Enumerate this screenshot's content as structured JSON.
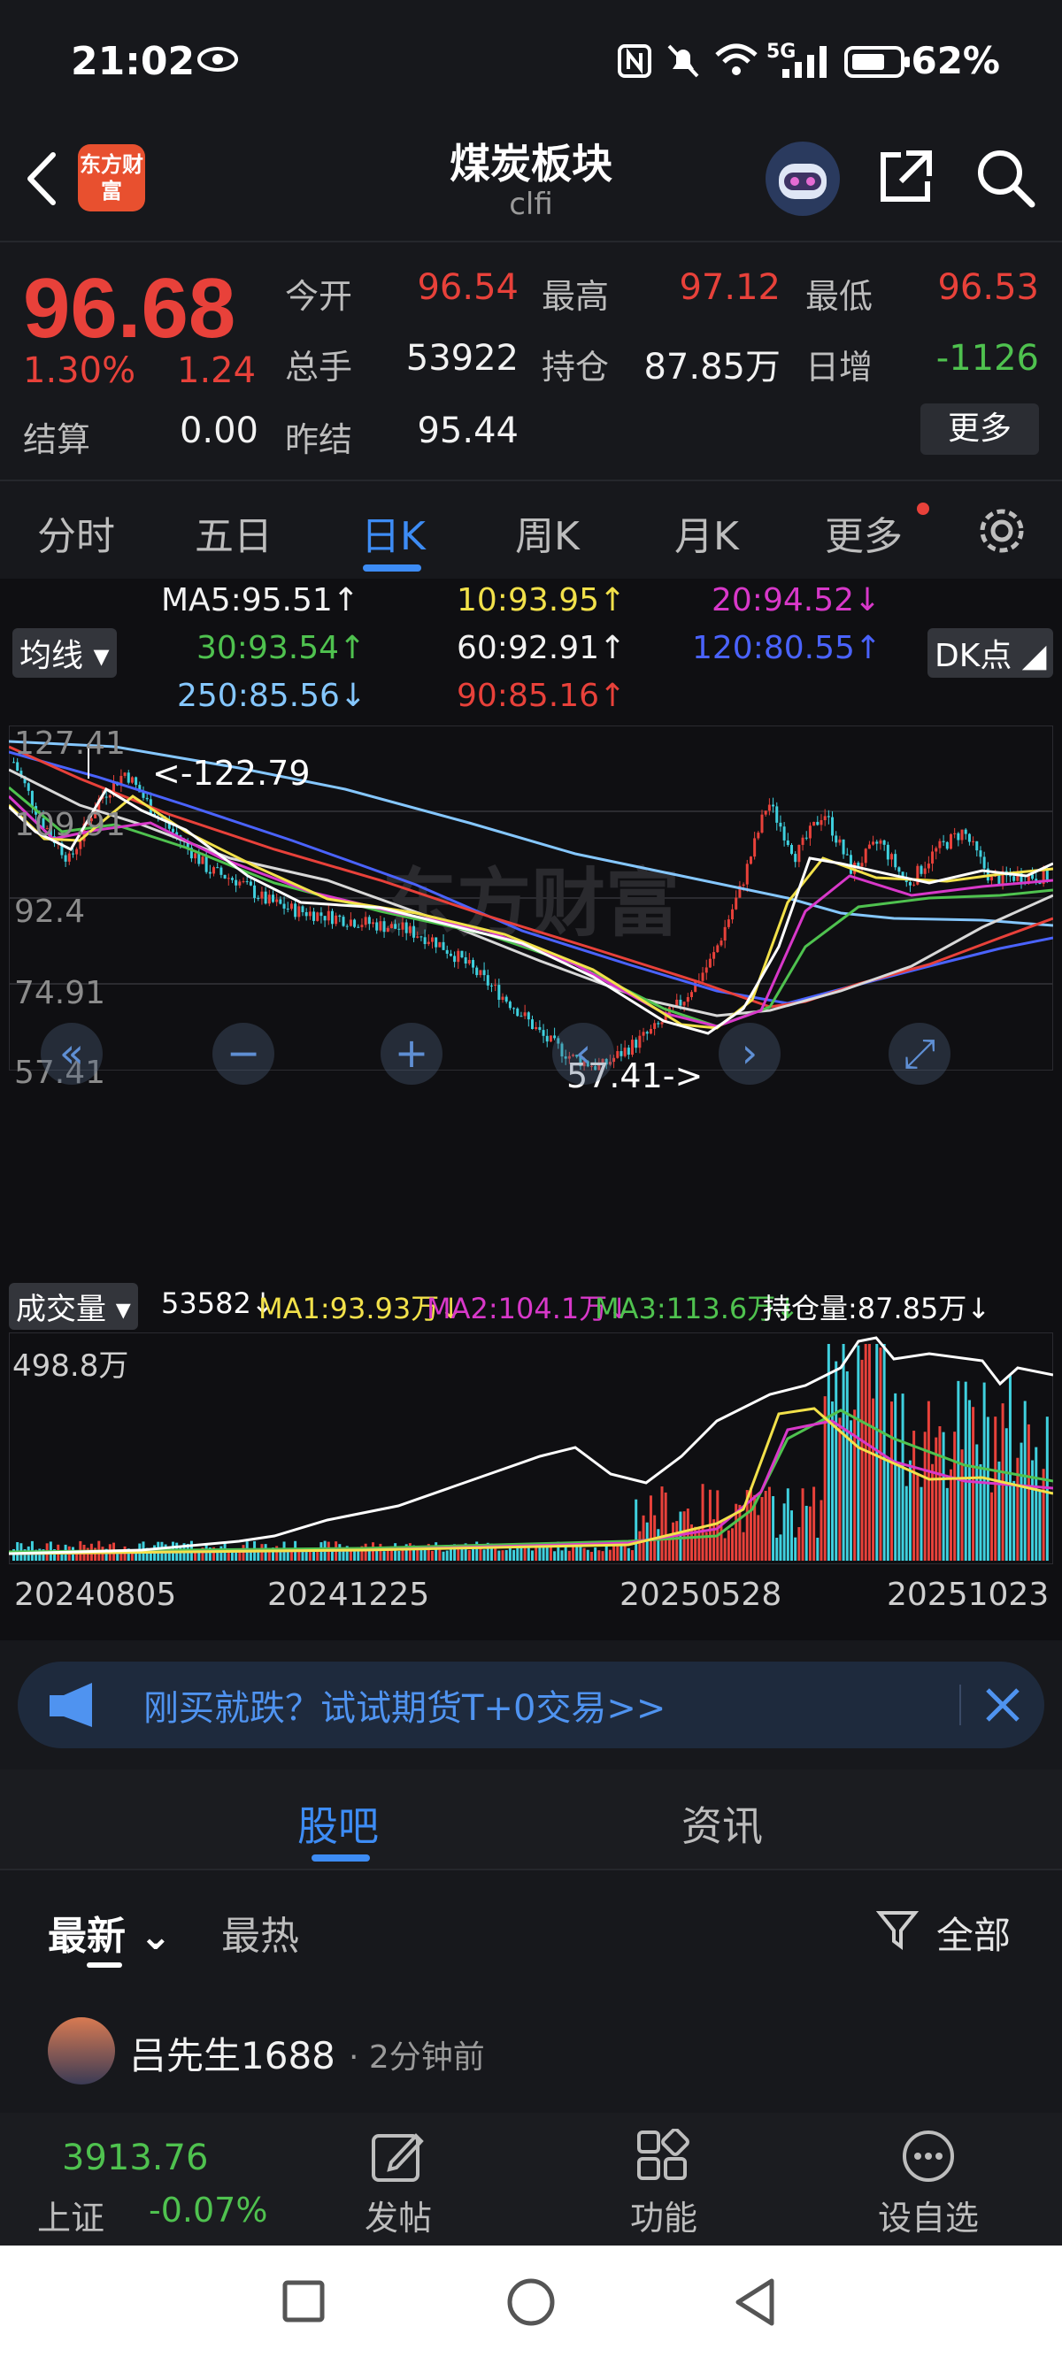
{
  "status_bar": {
    "time": "21:02",
    "network": "5G",
    "battery": "62%"
  },
  "header": {
    "title": "煤炭板块",
    "subtitle": "clfi",
    "logo_text": "东方财富"
  },
  "quote": {
    "price": "96.68",
    "change_pct": "1.30%",
    "change_abs": "1.24",
    "open_label": "今开",
    "open": "96.54",
    "high_label": "最高",
    "high": "97.12",
    "low_label": "最低",
    "low": "96.53",
    "volume_label": "总手",
    "volume": "53922",
    "position_label": "持仓",
    "position": "87.85万",
    "daily_inc_label": "日增",
    "daily_inc": "-1126",
    "settle_label": "结算",
    "settle": "0.00",
    "prev_settle_label": "昨结",
    "prev_settle": "95.44",
    "more_label": "更多"
  },
  "period_tabs": [
    "分时",
    "五日",
    "日K",
    "周K",
    "月K",
    "更多"
  ],
  "active_tab": "日K",
  "chart": {
    "ma_selector": "均线",
    "dk_button": "DK点",
    "ma": {
      "ma5": "MA5:95.51↑",
      "ma10": "10:93.95↑",
      "ma20": "20:94.52↓",
      "ma30": "30:93.54↑",
      "ma60": "60:92.91↑",
      "ma120": "120:80.55↑",
      "ma250": "250:85.56↓",
      "ma90": "90:85.16↑"
    },
    "y_labels": [
      "127.41",
      "109.91",
      "92.4",
      "74.91",
      "57.41"
    ],
    "high_marker": "<-122.79",
    "low_marker": "57.41->",
    "watermark": "东方财富",
    "volume_selector": "成交量",
    "volume_legend": {
      "vol": "53582↓",
      "ma1": "MA1:93.93万↓",
      "ma2": "MA2:104.1万↓",
      "ma3": "MA3:113.6万↓",
      "oi": "持仓量:87.85万↓"
    },
    "volume_max": "498.8万",
    "dates": [
      "20240805",
      "20241225",
      "20250528",
      "20251023"
    ]
  },
  "chart_data": {
    "type": "candlestick",
    "ylim": [
      57.41,
      127.41
    ],
    "high": 122.79,
    "low": 57.41,
    "x_dates": [
      "20240805",
      "20241225",
      "20250528",
      "20251023"
    ],
    "close_trend": [
      120,
      108,
      100,
      112,
      118,
      110,
      104,
      98,
      96,
      92,
      90,
      89,
      88,
      87,
      86,
      84,
      80,
      75,
      70,
      64,
      60,
      58,
      62,
      66,
      72,
      80,
      94,
      112,
      101,
      110,
      98,
      104,
      95,
      102,
      106,
      96,
      97,
      96.68
    ],
    "volume_max": "498.8万"
  },
  "banner": {
    "text": "刚买就跌？试试期货T+0交易>>"
  },
  "feed_tabs": [
    "股吧",
    "资讯"
  ],
  "active_feed_tab": "股吧",
  "sort": {
    "latest": "最新",
    "hot": "最热",
    "filter": "全部"
  },
  "post": {
    "author": "吕先生1688",
    "time": "· 2分钟前"
  },
  "bottom_nav": {
    "index_value": "3913.76",
    "index_name": "上证",
    "index_change": "-0.07%",
    "post": "发帖",
    "func": "功能",
    "watch": "设自选"
  }
}
